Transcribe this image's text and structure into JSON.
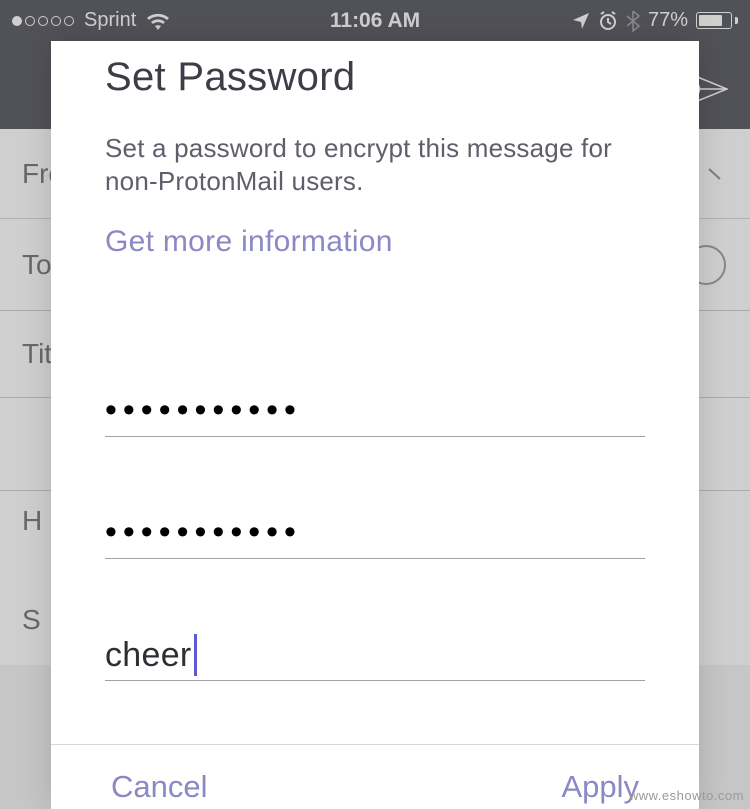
{
  "status_bar": {
    "carrier": "Sprint",
    "time": "11:06 AM",
    "battery_percent": "77%"
  },
  "compose": {
    "from_label": "Fro",
    "to_label": "To",
    "title_label": "Tit",
    "h_label": "H",
    "s_label": "S"
  },
  "modal": {
    "title": "Set Password",
    "description": "Set a password to encrypt this message for non-ProtonMail users.",
    "link": "Get more information",
    "password_value": "•••••••••••",
    "confirm_value": "•••••••••••",
    "hint_value": "cheer",
    "cancel": "Cancel",
    "apply": "Apply"
  },
  "watermark": "www.eshowto.com"
}
